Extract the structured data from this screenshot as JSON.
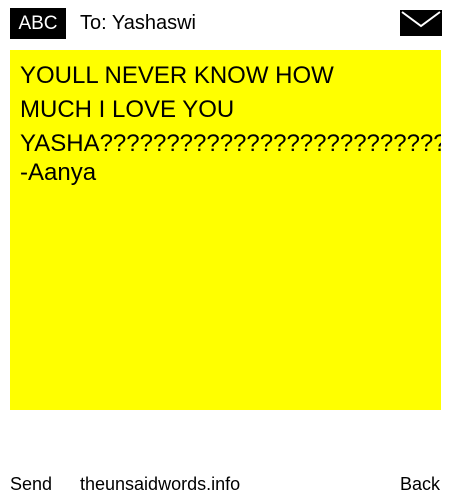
{
  "header": {
    "badge_label": "ABC",
    "recipient": "To: Yashaswi",
    "mail_icon": "envelope-icon"
  },
  "note": {
    "background_color": "#ffff00",
    "lines": [
      "YOULL NEVER KNOW HOW",
      "MUCH I LOVE YOU",
      "YASHA??????????????????????????"
    ],
    "signature": "-Aanya"
  },
  "footer": {
    "send_label": "Send",
    "site_label": "theunsaidwords.info",
    "back_label": "Back"
  }
}
